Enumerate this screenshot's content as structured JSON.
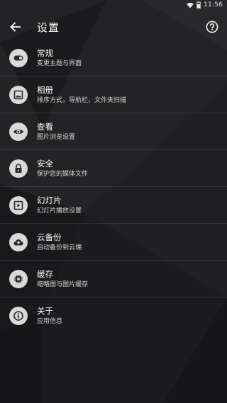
{
  "status_bar": {
    "time": "11:56"
  },
  "toolbar": {
    "title": "设置",
    "back_icon": "arrow-back-icon",
    "help_icon": "help-circle-icon"
  },
  "settings": [
    {
      "title": "常规",
      "subtitle": "变更主题与界面",
      "icon": "toggle-icon"
    },
    {
      "title": "相册",
      "subtitle": "排序方式，导航栏，文件夹扫描",
      "icon": "image-icon"
    },
    {
      "title": "查看",
      "subtitle": "图片浏览设置",
      "icon": "eye-icon"
    },
    {
      "title": "安全",
      "subtitle": "保护您的媒体文件",
      "icon": "lock-icon"
    },
    {
      "title": "幻灯片",
      "subtitle": "幻灯片播放设置",
      "icon": "slideshow-icon"
    },
    {
      "title": "云备份",
      "subtitle": "自动备份到云端",
      "icon": "cloud-upload-icon"
    },
    {
      "title": "缓存",
      "subtitle": "缩略图与图片缓存",
      "icon": "chip-icon"
    },
    {
      "title": "关于",
      "subtitle": "应用信息",
      "icon": "info-icon"
    }
  ],
  "colors": {
    "background": "#1e1e20",
    "icon_circle": "#d9d9d9",
    "icon_glyph": "#2a2a2c",
    "text_primary": "#ffffff",
    "text_secondary": "#d6d6d6"
  }
}
